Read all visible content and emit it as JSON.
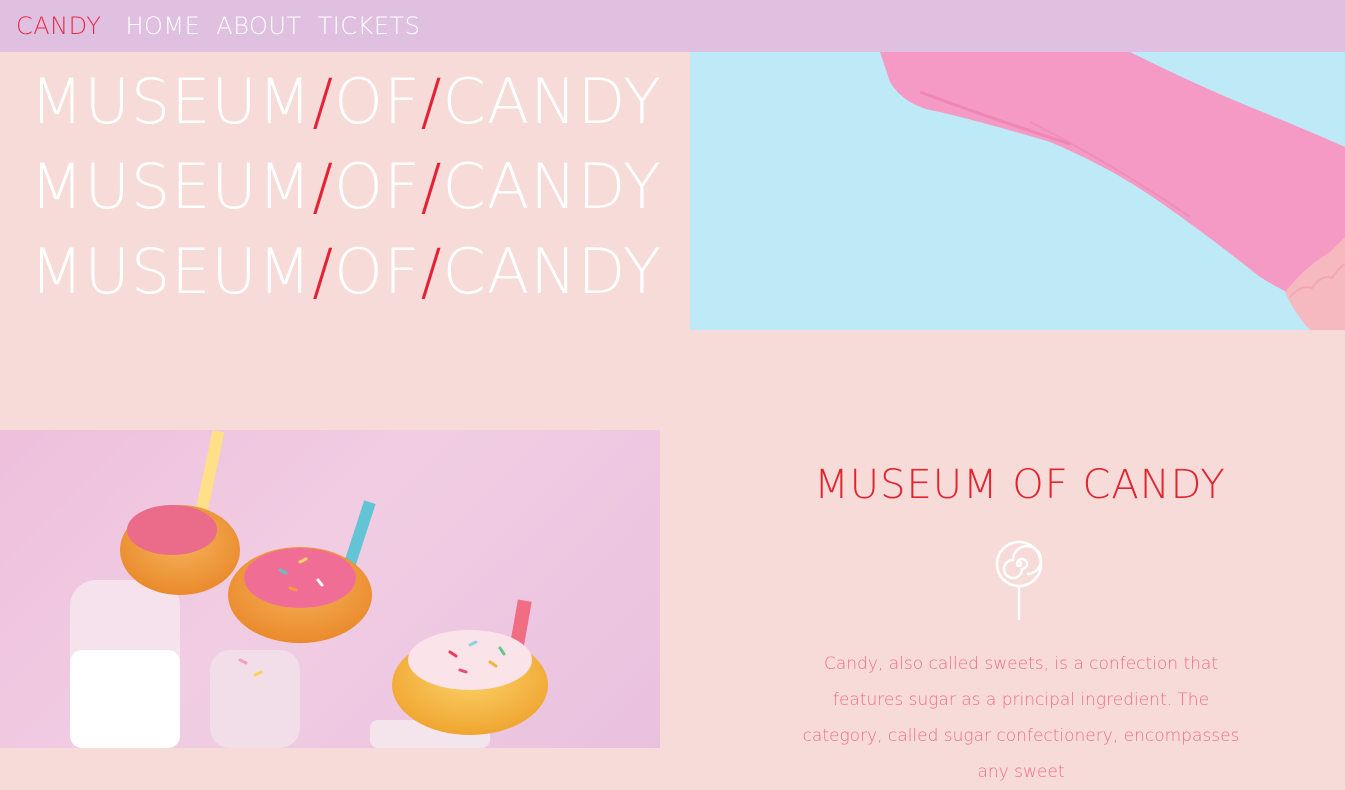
{
  "nav": {
    "brand": "CANDY",
    "links": [
      "HOME",
      "ABOUT",
      "TICKETS"
    ]
  },
  "hero": {
    "lines": [
      [
        "MUSEUM",
        "/",
        "OF",
        "/",
        "CANDY"
      ],
      [
        "MUSEUM",
        "/",
        "OF",
        "/",
        "CANDY"
      ],
      [
        "MUSEUM",
        "/",
        "OF",
        "/",
        "CANDY"
      ]
    ]
  },
  "images": {
    "glove": "pink-rubber-glove-holding-donut",
    "donuts": "sprinkled-donuts-on-milk-bottles"
  },
  "info": {
    "title": "MUSEUM OF CANDY",
    "icon": "lollipop-icon",
    "text": "Candy, also called sweets, is a confection that features sugar as a principal ingredient. The category, called sugar confectionery, encompasses any sweet"
  },
  "colors": {
    "nav_bg": "#e0c0e0",
    "page_bg": "#f6dbd8",
    "accent_red": "#e52235",
    "body_text_pink": "#ef6d8c",
    "glove_bg": "#bee9f7"
  }
}
